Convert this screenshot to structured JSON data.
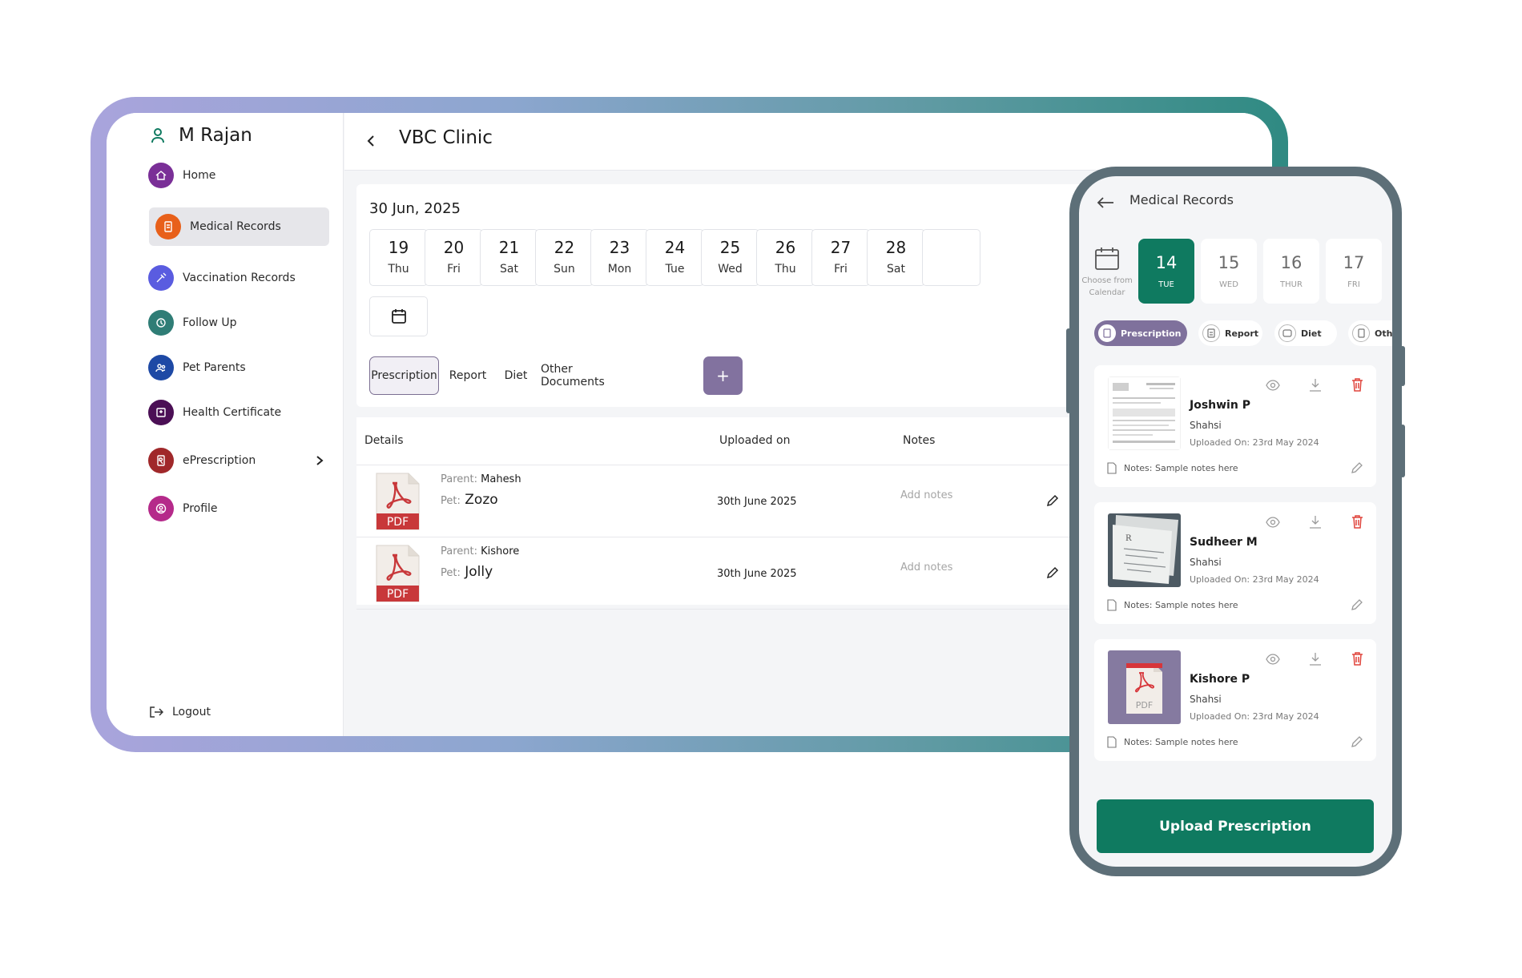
{
  "sidebar": {
    "user_name": "M Rajan",
    "items": [
      {
        "label": "Home",
        "icon": "home-icon",
        "color": "#7a2f97"
      },
      {
        "label": "Medical Records",
        "icon": "document-icon",
        "color": "#e8601a"
      },
      {
        "label": "Vaccination Records",
        "icon": "syringe-icon",
        "color": "#5a5ce0"
      },
      {
        "label": "Follow Up",
        "icon": "follow-up-icon",
        "color": "#2f7d76"
      },
      {
        "label": "Pet Parents",
        "icon": "people-icon",
        "color": "#1e49a5"
      },
      {
        "label": "Health Certificate",
        "icon": "certificate-icon",
        "color": "#4b0f55"
      },
      {
        "label": "ePrescription",
        "icon": "prescription-icon",
        "color": "#a0282a"
      },
      {
        "label": "Profile",
        "icon": "profile-icon",
        "color": "#b52a8a"
      }
    ],
    "logout_label": "Logout"
  },
  "header": {
    "title": "VBC Clinic"
  },
  "calendar": {
    "date_title": "30 Jun, 2025",
    "days": [
      {
        "num": "19",
        "name": "Thu"
      },
      {
        "num": "20",
        "name": "Fri"
      },
      {
        "num": "21",
        "name": "Sat"
      },
      {
        "num": "22",
        "name": "Sun"
      },
      {
        "num": "23",
        "name": "Mon"
      },
      {
        "num": "24",
        "name": "Tue"
      },
      {
        "num": "25",
        "name": "Wed"
      },
      {
        "num": "26",
        "name": "Thu"
      },
      {
        "num": "27",
        "name": "Fri"
      },
      {
        "num": "28",
        "name": "Sat"
      }
    ]
  },
  "tabs": [
    "Prescription",
    "Report",
    "Diet",
    "Other Documents"
  ],
  "add_label": "+",
  "table": {
    "headers": {
      "details": "Details",
      "uploaded": "Uploaded on",
      "notes": "Notes"
    },
    "parent_label": "Parent:",
    "pet_label": "Pet:",
    "pdf_label": "PDF",
    "rows": [
      {
        "parent": "Mahesh",
        "pet": "Zozo",
        "uploaded": "30th June 2025",
        "notes": "Add notes"
      },
      {
        "parent": "Kishore",
        "pet": "Jolly",
        "uploaded": "30th June 2025",
        "notes": "Add notes"
      }
    ]
  },
  "phone": {
    "title": "Medical Records",
    "cal_label_1": "Choose from",
    "cal_label_2": "Calendar",
    "days": [
      {
        "num": "14",
        "name": "TUE"
      },
      {
        "num": "15",
        "name": "WED"
      },
      {
        "num": "16",
        "name": "THUR"
      },
      {
        "num": "17",
        "name": "FRI"
      }
    ],
    "pills": [
      "Prescription",
      "Report",
      "Diet",
      "Othe"
    ],
    "records": [
      {
        "name": "Joshwin P",
        "sub": "Shahsi",
        "date": "Uploaded On: 23rd May 2024",
        "note": "Notes: Sample notes here"
      },
      {
        "name": "Sudheer M",
        "sub": "Shahsi",
        "date": "Uploaded On: 23rd May 2024",
        "note": "Notes: Sample notes here"
      },
      {
        "name": "Kishore P",
        "sub": "Shahsi",
        "date": "Uploaded On: 23rd May 2024",
        "note": "Notes: Sample notes here"
      }
    ],
    "pdf_label": "PDF",
    "upload_label": "Upload Prescription"
  },
  "colors": {
    "accent_green": "#0f7a60",
    "accent_purple": "#82729f",
    "delete_red": "#e0443c"
  }
}
